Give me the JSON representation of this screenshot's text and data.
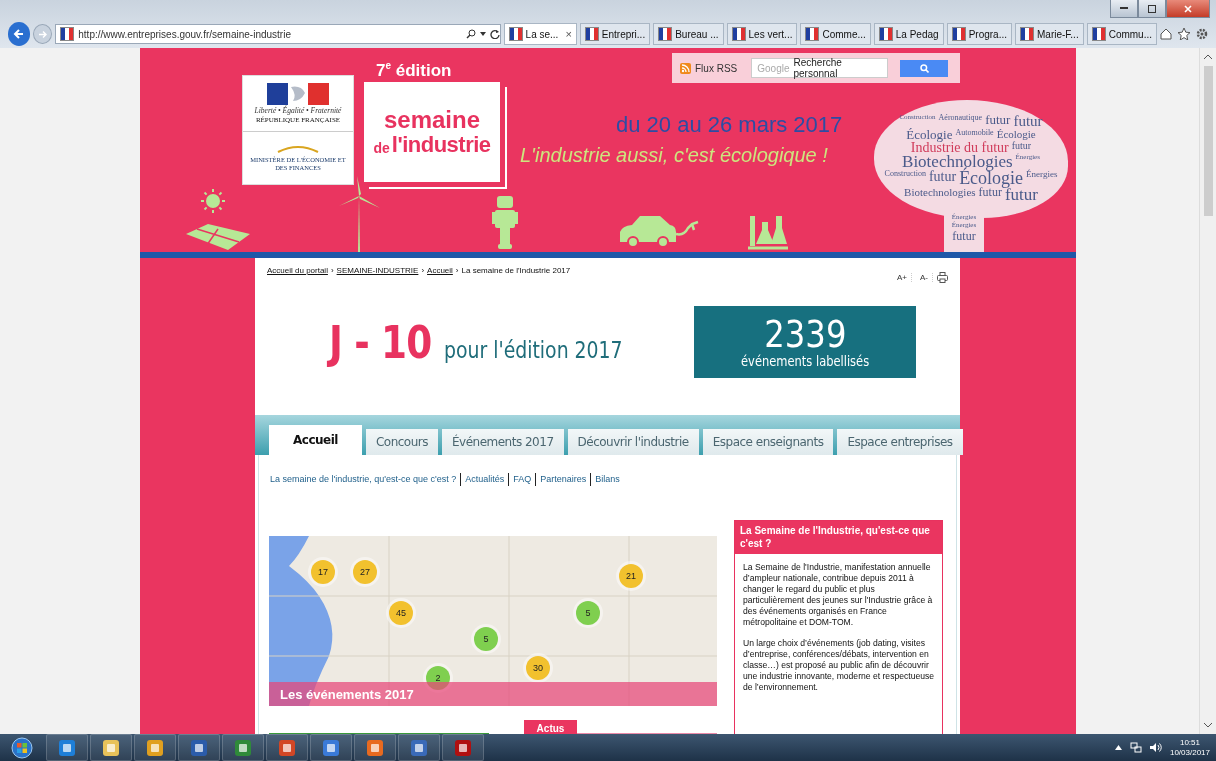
{
  "browser": {
    "address": "http://www.entreprises.gouv.fr/semaine-industrie",
    "close": "×",
    "tabs": [
      {
        "label": "La se...",
        "selected": true
      },
      {
        "label": "Entrepri...",
        "selected": false
      },
      {
        "label": "Bureau ...",
        "selected": false
      },
      {
        "label": "Les vert...",
        "selected": false
      },
      {
        "label": "Comme...",
        "selected": false
      },
      {
        "label": "La Pedag",
        "selected": false
      },
      {
        "label": "Progra...",
        "selected": false
      },
      {
        "label": "Marie-F...",
        "selected": false
      },
      {
        "label": "Commu...",
        "selected": false
      }
    ]
  },
  "header": {
    "rss": "Flux RSS",
    "search": {
      "brand": "Google",
      "placeholder": "Recherche personnal"
    },
    "logo": {
      "motto": "Liberté • Égalité • Fraternité",
      "republic": "RÉPUBLIQUE FRANÇAISE",
      "ministry": "MINISTÈRE DE L'ÉCONOMIE ET DES FINANCES"
    },
    "edition": {
      "number": "7$^{e}$ édition",
      "line1": "semaine",
      "line2_prefix": "de",
      "line2": "l'industrie"
    },
    "dates": "du 20 au 26 mars 2017",
    "slogan": "L'industrie aussi, c'est écologique !",
    "word_cloud": [
      "Construction",
      "Aéronautique",
      "futur",
      "futur",
      "Écologie",
      "Automobile",
      "Écologie",
      "Industrie du futur",
      "futur",
      "Biotechnologies",
      "Énergies",
      "Construction",
      "futur",
      "Écologie",
      "Énergies",
      "Biotechnologies",
      "futur",
      "futur",
      "Énergies",
      "Énergies",
      "futur"
    ]
  },
  "breadcrumb": {
    "links": [
      "Accueil du portail",
      "SEMAINE-INDUSTRIE",
      "Accueil"
    ],
    "separator": "›",
    "current": "La semaine de l'Industrie 2017"
  },
  "tools": [
    "A+",
    "A-"
  ],
  "countdown": {
    "value": "J - 10",
    "caption": "pour l'édition 2017"
  },
  "counter": {
    "value": "2339",
    "caption": "événements labellisés"
  },
  "tabs": [
    {
      "label": "Accueil",
      "selected": true
    },
    {
      "label": "Concours",
      "selected": false
    },
    {
      "label": "Événements 2017",
      "selected": false
    },
    {
      "label": "Découvrir l'industrie",
      "selected": false
    },
    {
      "label": "Espace enseignants",
      "selected": false
    },
    {
      "label": "Espace entreprises",
      "selected": false
    }
  ],
  "sub_links": [
    "La semaine de l'industrie, qu'est-ce que c'est ?",
    "Actualités",
    "FAQ",
    "Partenaires",
    "Bilans"
  ],
  "map": {
    "caption": "Les événements 2017",
    "markers": [
      {
        "label": "17",
        "color": "#f2c12e"
      },
      {
        "label": "27",
        "color": "#f2c12e"
      },
      {
        "label": "21",
        "color": "#f2c12e"
      },
      {
        "label": "45",
        "color": "#f2c12e"
      },
      {
        "label": "5",
        "color": "#7fcf4f"
      },
      {
        "label": "5",
        "color": "#7fcf4f"
      },
      {
        "label": "30",
        "color": "#f2c12e"
      },
      {
        "label": "2",
        "color": "#7fcf4f"
      }
    ]
  },
  "info": {
    "title": "La Semaine de l'Industrie, qu'est-ce que c'est ?",
    "paragraphs": [
      "La Semaine de l'Industrie, manifestation annuelle d’ampleur nationale, contribue depuis 2011 à changer le regard du public et plus particulièrement des jeunes sur l'Industrie grâce à des événements organisés en France métropolitaine et DOM-TOM.",
      "Un large choix d’événements (job dating, visites d’entreprise, conférences/débats, intervention en classe…)  est proposé au public afin de découvrir une industrie innovante, moderne et respectueuse de l’environnement."
    ]
  },
  "actus": "Actus",
  "taskbar": {
    "time": "10:51",
    "date": "10/03/2017"
  }
}
